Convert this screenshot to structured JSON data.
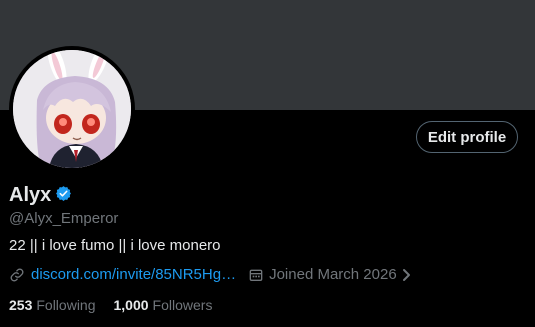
{
  "profile": {
    "display_name": "Alyx",
    "handle": "@Alyx_Emperor",
    "bio": "22 || i love fumo || i love monero",
    "link_text": "discord.com/invite/85NR5Hg…",
    "joined": "Joined March 2026",
    "following_count": "253",
    "following_label": "Following",
    "followers_count": "1,000",
    "followers_label": "Followers",
    "edit_button_label": "Edit profile"
  },
  "colors": {
    "background": "#000000",
    "banner": "#333639",
    "primary_text": "#e7e9ea",
    "secondary_text": "#71767b",
    "link": "#1d9bf0",
    "verified_badge": "#1d9bf0",
    "button_border": "#536471"
  },
  "icons": {
    "verified": "verified-badge-icon",
    "link": "link-icon",
    "calendar": "calendar-icon",
    "chevron": "chevron-right-icon"
  }
}
